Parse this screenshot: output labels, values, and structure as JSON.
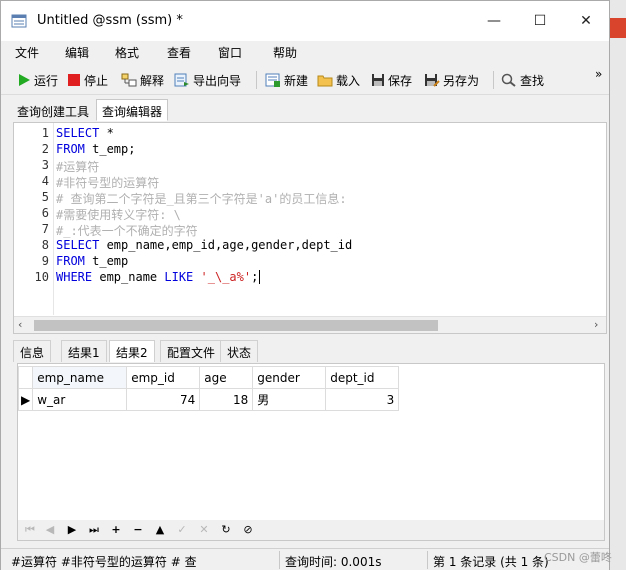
{
  "window": {
    "title": "Untitled @ssm (ssm) *",
    "controls": {
      "minimize": "—",
      "maximize": "☐",
      "close": "✕"
    }
  },
  "menu": [
    "文件",
    "编辑",
    "格式",
    "查看",
    "窗口",
    "帮助"
  ],
  "toolbar": {
    "run": "运行",
    "stop": "停止",
    "explain": "解释",
    "export_wizard": "导出向导",
    "new": "新建",
    "load": "载入",
    "save": "保存",
    "save_as": "另存为",
    "find": "查找",
    "overflow": "»"
  },
  "query_tabs": [
    "查询创建工具",
    "查询编辑器"
  ],
  "editor": {
    "line_numbers": [
      "1",
      "2",
      "3",
      "4",
      "5",
      "6",
      "7",
      "8",
      "9",
      "10"
    ],
    "lines": {
      "l1_kw": "SELECT",
      "l1_rest": " *",
      "l2_kw": "FROM",
      "l2_rest": " t_emp;",
      "l3": "#运算符",
      "l4": "#非符号型的运算符",
      "l5": "# 查询第二个字符是_且第三个字符是'a'的员工信息:",
      "l6": "#需要使用转义字符: \\",
      "l7": "#_:代表一个不确定的字符",
      "l8_kw": "SELECT",
      "l8_rest": " emp_name,emp_id,age,gender,dept_id",
      "l9_kw": "FROM",
      "l9_rest": " t_emp",
      "l10_kw": "WHERE",
      "l10_mid": " emp_name ",
      "l10_kw2": "LIKE",
      "l10_sp": " ",
      "l10_str": "'_\\_a%'",
      "l10_end": ";"
    }
  },
  "result_tabs": [
    "信息",
    "结果1",
    "结果2",
    "配置文件",
    "状态"
  ],
  "result_grid": {
    "columns": [
      "emp_name",
      "emp_id",
      "age",
      "gender",
      "dept_id"
    ],
    "rows": [
      {
        "emp_name": "w_ar",
        "emp_id": "74",
        "age": "18",
        "gender": "男",
        "dept_id": "3"
      }
    ]
  },
  "status_bar": {
    "sql_preview": "#运算符 #非符号型的运算符 # 查",
    "query_time": "查询时间: 0.001s",
    "record_info": "第 1 条记录 (共 1 条)"
  },
  "watermark": "CSDN @蕾咚",
  "colors": {
    "keyword": "#0000dd",
    "comment": "#b0b0b0",
    "string": "#cc2222",
    "stop_red": "#e02020",
    "run_green": "#22aa22"
  }
}
